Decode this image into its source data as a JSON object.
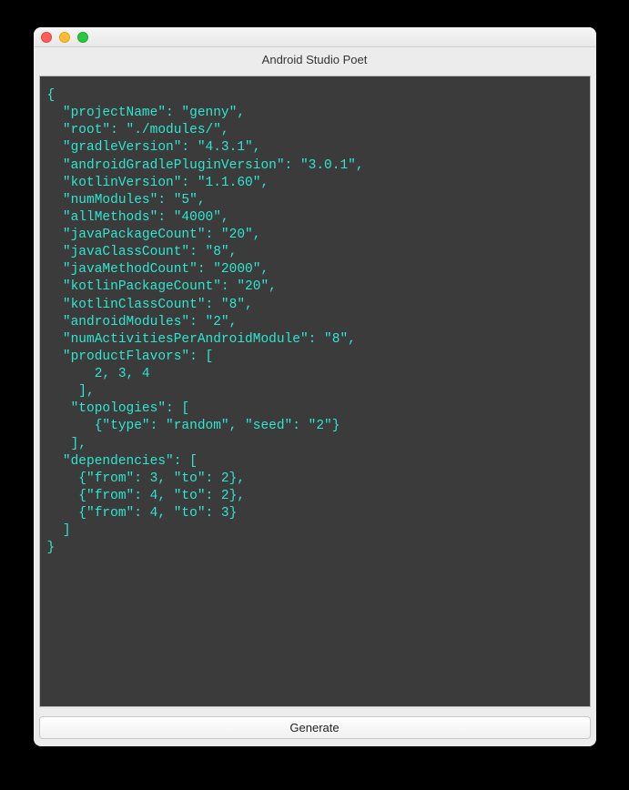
{
  "window": {
    "title": "Android Studio Poet"
  },
  "editor": {
    "content": "{\n  \"projectName\": \"genny\",\n  \"root\": \"./modules/\",\n  \"gradleVersion\": \"4.3.1\",\n  \"androidGradlePluginVersion\": \"3.0.1\",\n  \"kotlinVersion\": \"1.1.60\",\n  \"numModules\": \"5\",\n  \"allMethods\": \"4000\",\n  \"javaPackageCount\": \"20\",\n  \"javaClassCount\": \"8\",\n  \"javaMethodCount\": \"2000\",\n  \"kotlinPackageCount\": \"20\",\n  \"kotlinClassCount\": \"8\",\n  \"androidModules\": \"2\",\n  \"numActivitiesPerAndroidModule\": \"8\",\n  \"productFlavors\": [\n      2, 3, 4\n    ],\n   \"topologies\": [\n      {\"type\": \"random\", \"seed\": \"2\"}\n   ],\n  \"dependencies\": [\n    {\"from\": 3, \"to\": 2},\n    {\"from\": 4, \"to\": 2},\n    {\"from\": 4, \"to\": 3}\n  ]\n}"
  },
  "buttons": {
    "generate": "Generate"
  }
}
